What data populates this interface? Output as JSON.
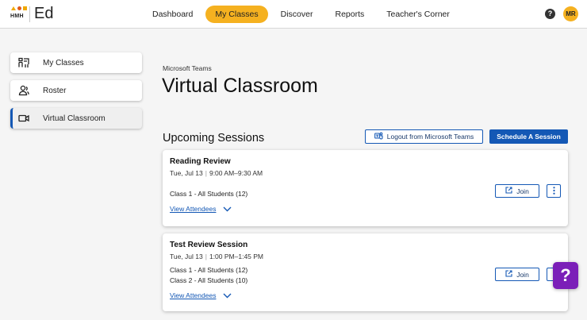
{
  "header": {
    "logo_text": "HMH",
    "brand": "Ed",
    "nav": [
      {
        "label": "Dashboard",
        "active": false
      },
      {
        "label": "My Classes",
        "active": true
      },
      {
        "label": "Discover",
        "active": false
      },
      {
        "label": "Reports",
        "active": false
      },
      {
        "label": "Teacher's Corner",
        "active": false
      }
    ],
    "help_icon": "?",
    "avatar_initials": "MR"
  },
  "sidebar": {
    "items": [
      {
        "label": "My Classes",
        "icon": "classroom-icon",
        "active": false
      },
      {
        "label": "Roster",
        "icon": "people-icon",
        "active": false
      },
      {
        "label": "Virtual Classroom",
        "icon": "video-camera-icon",
        "active": true
      }
    ]
  },
  "main": {
    "overline": "Microsoft Teams",
    "title": "Virtual Classroom",
    "section_title": "Upcoming Sessions",
    "logout_label": "Logout from Microsoft Teams",
    "schedule_label": "Schedule A Session",
    "sessions": [
      {
        "title": "Reading Review",
        "date": "Tue, Jul 13",
        "time": "9:00 AM–9:30 AM",
        "classes": [
          "Class 1 - All Students (12)"
        ],
        "view_attendees": "View Attendees",
        "join_label": "Join"
      },
      {
        "title": "Test Review Session",
        "date": "Tue, Jul 13",
        "time": "1:00 PM–1:45 PM",
        "classes": [
          "Class 1 - All Students (12)",
          "Class 2 - All Students (10)"
        ],
        "view_attendees": "View Attendees",
        "join_label": "Join"
      }
    ]
  },
  "help_fab": "?",
  "colors": {
    "accent_yellow": "#f5b120",
    "primary_blue": "#1458b5",
    "help_purple": "#7b1fb8"
  }
}
